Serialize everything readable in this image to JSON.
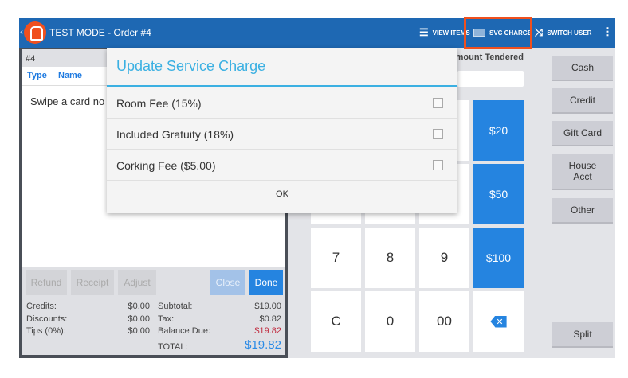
{
  "topbar": {
    "title": "TEST MODE - Order #4",
    "view_items": "VIEW ITEMS",
    "svc_charge": "SVC CHARGE",
    "switch_user": "SWITCH USER"
  },
  "order": {
    "number": "#4",
    "columns": [
      "Type",
      "Name"
    ],
    "message": "Swipe a card no"
  },
  "actions": {
    "refund": "Refund",
    "receipt": "Receipt",
    "adjust": "Adjust",
    "close": "Close",
    "done": "Done"
  },
  "totals": {
    "credits_label": "Credits:",
    "credits": "$0.00",
    "discounts_label": "Discounts:",
    "discounts": "$0.00",
    "tips_label": "Tips (0%):",
    "tips": "$0.00",
    "subtotal_label": "Subtotal:",
    "subtotal": "$19.00",
    "tax_label": "Tax:",
    "tax": "$0.82",
    "balance_label": "Balance Due:",
    "balance": "$19.82",
    "total_label": "TOTAL:",
    "total": "$19.82"
  },
  "dialog": {
    "title": "Update Service Charge",
    "options": [
      {
        "label": "Room Fee (15%)",
        "checked": false
      },
      {
        "label": "Included Gratuity (18%)",
        "checked": false
      },
      {
        "label": "Corking Fee ($5.00)",
        "checked": false
      }
    ],
    "ok": "OK"
  },
  "tender": {
    "label": "Amount Tendered",
    "value": ""
  },
  "keypad": {
    "k20": "$20",
    "k50": "$50",
    "k100": "$100",
    "k7": "7",
    "k8": "8",
    "k9": "9",
    "kc": "C",
    "k0": "0",
    "k00": "00"
  },
  "payments": {
    "cash": "Cash",
    "credit": "Credit",
    "gift": "Gift Card",
    "house": "House Acct",
    "other": "Other",
    "split": "Split"
  },
  "colors": {
    "topbar": "#1e68b3",
    "accent": "#2584e0",
    "highlight": "#f0501e",
    "balance": "#c0283c",
    "dialog_title": "#3bb0e2"
  }
}
